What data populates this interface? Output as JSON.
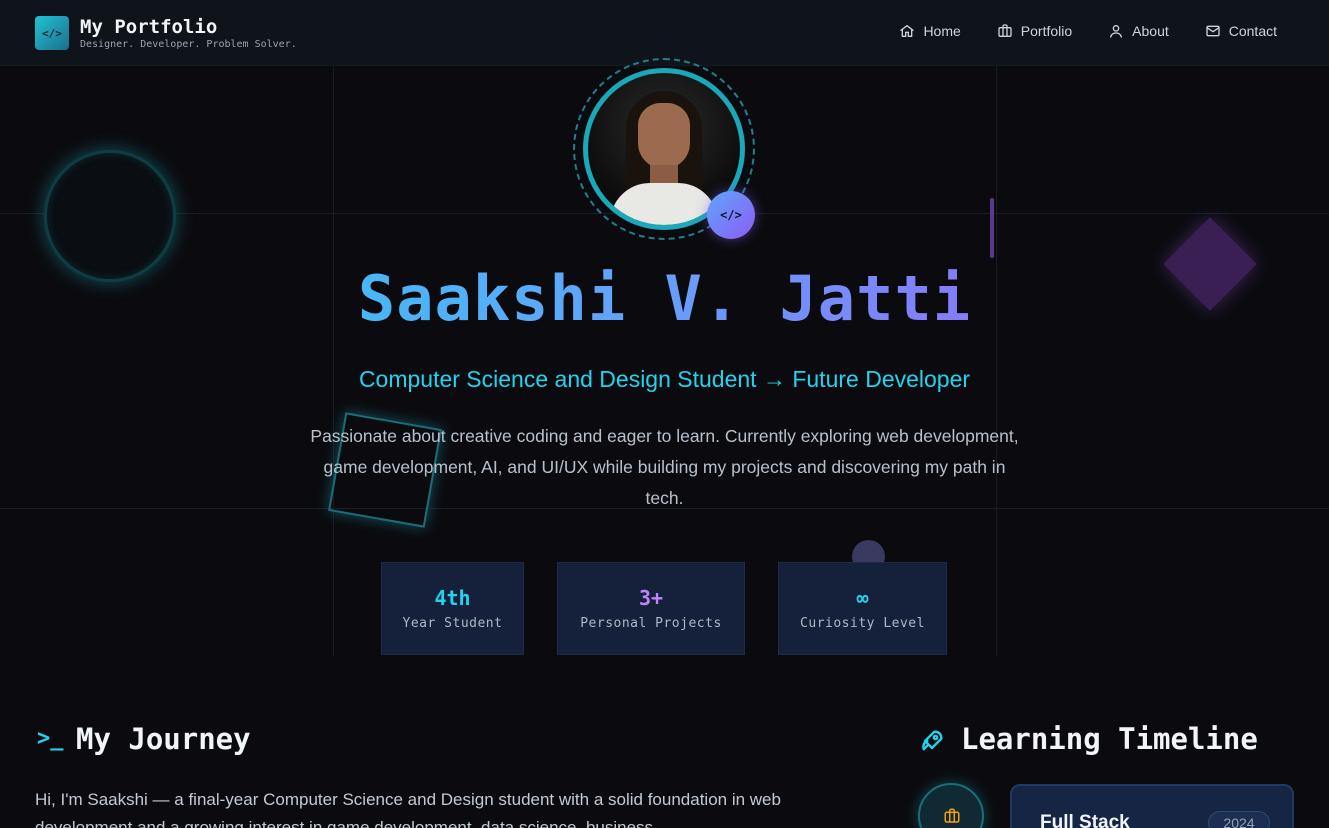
{
  "header": {
    "logo_glyph": "</>",
    "title": "My Portfolio",
    "tagline": "Designer. Developer. Problem Solver.",
    "nav": [
      {
        "label": "Home",
        "icon": "home-icon"
      },
      {
        "label": "Portfolio",
        "icon": "briefcase-icon"
      },
      {
        "label": "About",
        "icon": "user-icon"
      },
      {
        "label": "Contact",
        "icon": "mail-icon"
      }
    ]
  },
  "hero": {
    "avatar_badge": "</>",
    "name": "Saakshi V. Jatti",
    "role": "Computer Science and Design Student → Future Developer",
    "description": "Passionate about creative coding and eager to learn. Currently exploring web development, game development, AI, and UI/UX while building my projects and discovering my path in tech.",
    "stats": [
      {
        "value": "4th",
        "label": "Year Student",
        "color": "#22d3ee"
      },
      {
        "value": "3+",
        "label": "Personal Projects",
        "color": "#c084fc"
      },
      {
        "value": "∞",
        "label": "Curiosity Level",
        "color": "#22d3ee"
      }
    ]
  },
  "journey": {
    "icon_glyph": ">_",
    "title": "My Journey",
    "text": "Hi, I'm Saakshi — a final-year Computer Science and Design student with a solid foundation in web development and a growing interest in game development, data science, business"
  },
  "timeline": {
    "title": "Learning Timeline",
    "icon": "rocket-icon",
    "items": [
      {
        "title": "Full Stack",
        "year": "2024",
        "icon": "briefcase-icon"
      }
    ]
  },
  "colors": {
    "accent_cyan": "#22d3ee",
    "accent_purple": "#a855f7",
    "background": "#0b0b0f"
  }
}
